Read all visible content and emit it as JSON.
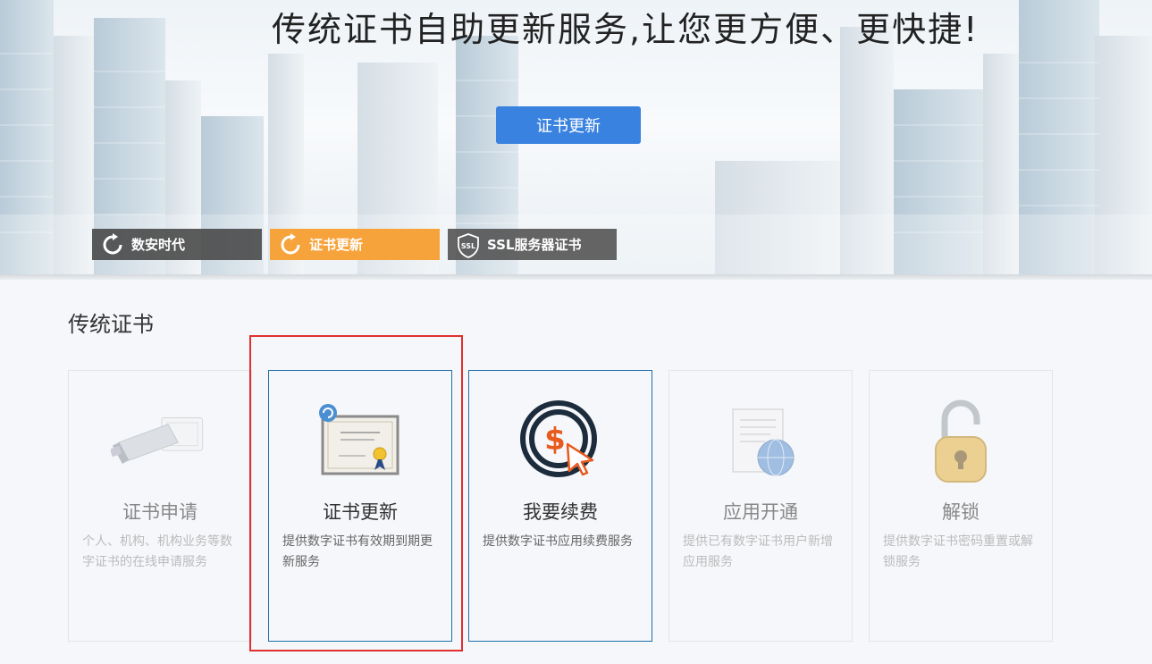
{
  "banner": {
    "title": "传统证书自助更新服务,让您更方便、更快捷!",
    "renew_button": "证书更新",
    "tabs": [
      {
        "label": "数安时代",
        "icon": "refresh-icon"
      },
      {
        "label": "证书更新",
        "icon": "refresh-icon"
      },
      {
        "label": "SSL服务器证书",
        "icon": "ssl-shield-icon",
        "icon_text": "SSL"
      }
    ]
  },
  "section": {
    "title": "传统证书",
    "cards": [
      {
        "title": "证书申请",
        "desc": "个人、机构、机构业务等数字证书的在线申请服务",
        "icon": "usb-key-icon",
        "state": "dim"
      },
      {
        "title": "证书更新",
        "desc": "提供数字证书有效期到期更新服务",
        "icon": "certificate-icon",
        "state": "active"
      },
      {
        "title": "我要续费",
        "desc": "提供数字证书应用续费服务",
        "icon": "dollar-click-icon",
        "state": "active"
      },
      {
        "title": "应用开通",
        "desc": "提供已有数字证书用户新增应用服务",
        "icon": "document-globe-icon",
        "state": "dim"
      },
      {
        "title": "解锁",
        "desc": "提供数字证书密码重置或解锁服务",
        "icon": "padlock-icon",
        "state": "dim"
      }
    ]
  },
  "colors": {
    "accent_blue": "#3a82e0",
    "tab_orange": "#f7a33b",
    "tab_dark": "#464646",
    "active_border": "#1f6fa8",
    "highlight_red": "#e03030"
  }
}
